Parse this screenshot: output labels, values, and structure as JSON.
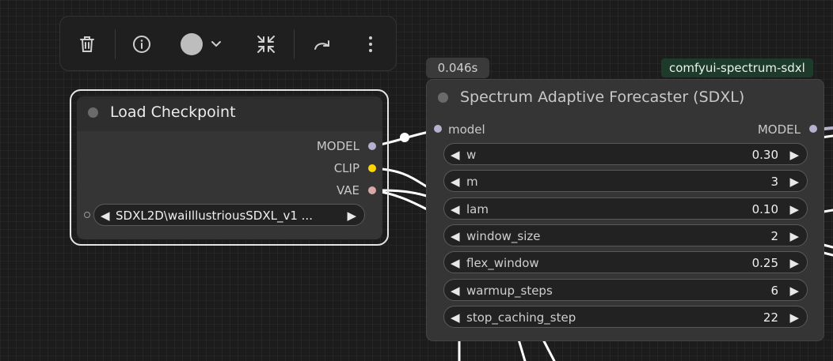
{
  "toolbar": {
    "delete_icon": "trash-icon",
    "info_icon": "info-icon",
    "color_icon": "color-circle-icon",
    "dropdown_icon": "chevron-down-icon",
    "collapse_icon": "collapse-arrows-icon",
    "bypass_icon": "redo-arrow-icon",
    "more_icon": "more-vertical-icon"
  },
  "load_checkpoint": {
    "title": "Load Checkpoint",
    "outputs": [
      {
        "label": "MODEL",
        "color": "#b7b0cf"
      },
      {
        "label": "CLIP",
        "color": "#ffd500"
      },
      {
        "label": "VAE",
        "color": "#d9a8a8"
      }
    ],
    "ckpt_widget": {
      "value": "SDXL2D\\waiIllustriousSDXL_v1 ..."
    }
  },
  "forecaster": {
    "badge_time": "0.046s",
    "tag": "comfyui-spectrum-sdxl",
    "title": "Spectrum Adaptive Forecaster (SDXL)",
    "input_label": "model",
    "output_label": "MODEL",
    "widgets": [
      {
        "name": "w",
        "value": "0.30"
      },
      {
        "name": "m",
        "value": "3"
      },
      {
        "name": "lam",
        "value": "0.10"
      },
      {
        "name": "window_size",
        "value": "2"
      },
      {
        "name": "flex_window",
        "value": "0.25"
      },
      {
        "name": "warmup_steps",
        "value": "6"
      },
      {
        "name": "stop_caching_step",
        "value": "22"
      }
    ]
  },
  "colors": {
    "model_slot": "#b7b0cf",
    "clip_slot": "#ffd500",
    "vae_slot": "#d9a8a8",
    "tag_bg": "#1e3a2a"
  },
  "arrows": {
    "left": "◀",
    "right": "▶"
  }
}
